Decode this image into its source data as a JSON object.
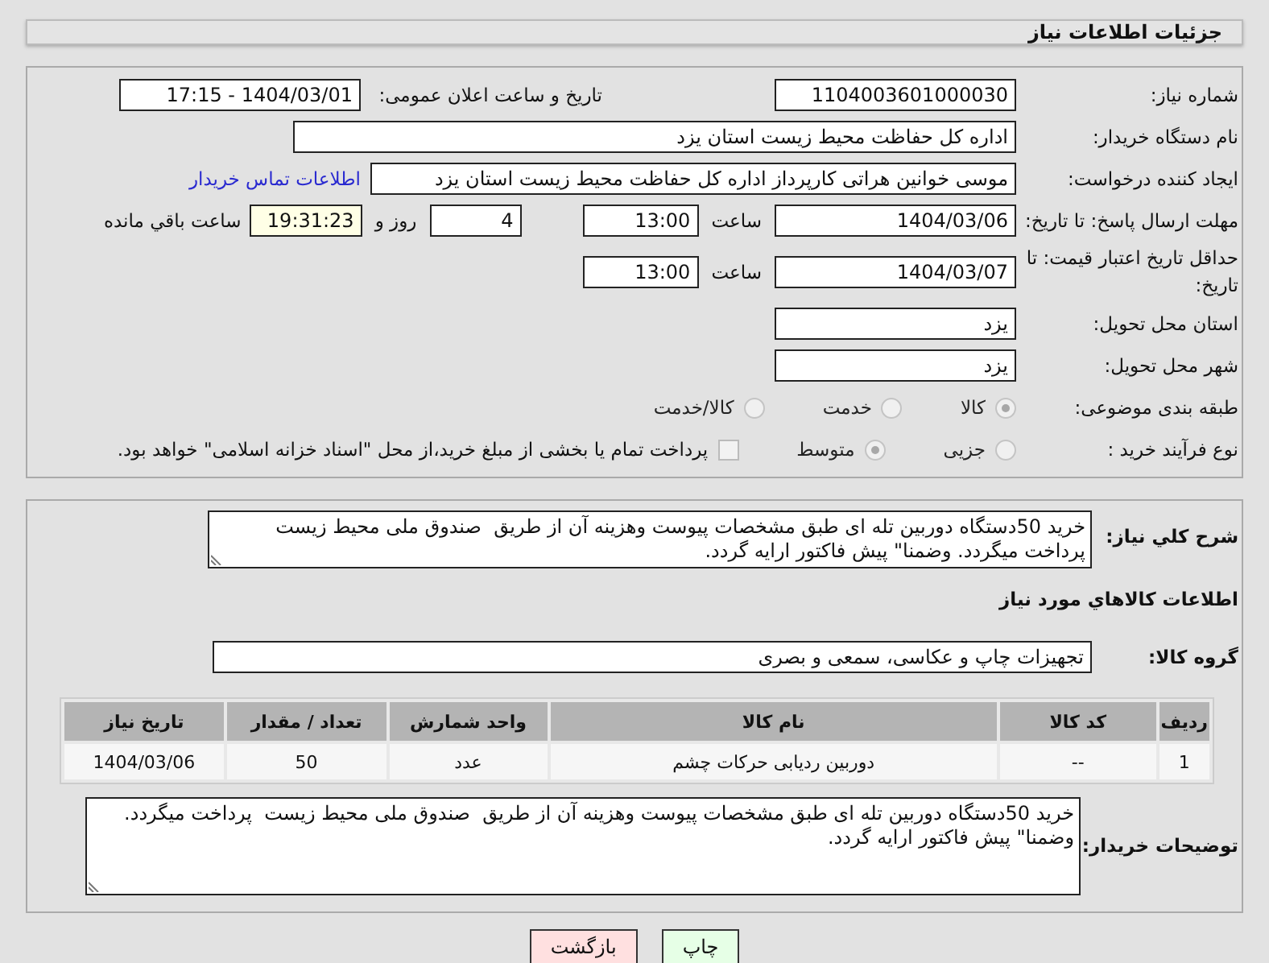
{
  "header": {
    "title": "جزئیات اطلاعات نیاز"
  },
  "need_number": {
    "label": "شماره نیاز:",
    "value": "1104003601000030"
  },
  "announce": {
    "label": "تاریخ و ساعت اعلان عمومی:",
    "value": "1404/03/01 - 17:15"
  },
  "buyer_org": {
    "label": "نام دستگاه خریدار:",
    "value": "اداره کل حفاظت محیط زیست استان یزد"
  },
  "requester": {
    "label": "ایجاد کننده درخواست:",
    "value": "موسی خوانین هراتی کارپرداز اداره کل حفاظت محیط زیست استان یزد",
    "link": "اطلاعات تماس خریدار"
  },
  "deadline": {
    "label": "مهلت ارسال پاسخ: تا تاریخ:",
    "date": "1404/03/06",
    "time_label": "ساعت",
    "time": "13:00",
    "days": "4",
    "days_label": "روز و",
    "remaining": "19:31:23",
    "remaining_label": "ساعت باقي مانده"
  },
  "price_validity": {
    "label": "حداقل تاریخ اعتبار قیمت: تا تاریخ:",
    "date": "1404/03/07",
    "time_label": "ساعت",
    "time": "13:00"
  },
  "province": {
    "label": "استان محل تحویل:",
    "value": "یزد"
  },
  "city": {
    "label": "شهر محل تحویل:",
    "value": "یزد"
  },
  "category": {
    "label": "طبقه بندی موضوعی:",
    "options": [
      {
        "label": "کالا",
        "selected": true
      },
      {
        "label": "خدمت",
        "selected": false
      },
      {
        "label": "کالا/خدمت",
        "selected": false
      }
    ]
  },
  "process": {
    "label": "نوع فرآیند خرید :",
    "options": [
      {
        "label": "جزیی",
        "selected": false
      },
      {
        "label": "متوسط",
        "selected": true
      }
    ],
    "payment": {
      "checked": false,
      "text": "پرداخت تمام یا بخشی از مبلغ خرید،از محل \"اسناد خزانه اسلامی\" خواهد بود."
    }
  },
  "description": {
    "label": "شرح کلي نیاز:",
    "text": "خرید 50دستگاه دوربین تله ای طبق مشخصات پیوست وهزینه آن از طریق  صندوق ملی محیط زیست  پرداخت میگردد. وضمنا\" پیش فاکتور ارایه گردد."
  },
  "goods_heading": "اطلاعات کالاهاي مورد نیاز",
  "goods_group": {
    "label": "گروه کالا:",
    "value": "تجهیزات چاپ و عکاسی، سمعی و بصری"
  },
  "table": {
    "columns": [
      "ردیف",
      "کد کالا",
      "نام کالا",
      "واحد شمارش",
      "تعداد / مقدار",
      "تاریخ نیاز"
    ],
    "rows": [
      [
        "1",
        "--",
        "دوربین ردیابی حرکات چشم",
        "عدد",
        "50",
        "1404/03/06"
      ]
    ]
  },
  "buyer_notes": {
    "label": "توضیحات خریدار:",
    "text": "خرید 50دستگاه دوربین تله ای طبق مشخصات پیوست وهزینه آن از طریق  صندوق ملی محیط زیست  پرداخت میگردد.\nوضمنا\" پیش فاکتور ارایه گردد."
  },
  "buttons": [
    {
      "label": "چاپ",
      "kind": "print"
    },
    {
      "label": "بازگشت",
      "kind": "back"
    }
  ]
}
